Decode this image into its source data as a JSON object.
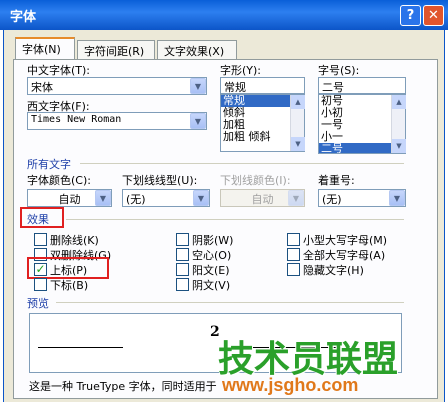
{
  "window": {
    "title": "字体",
    "help_label": "?",
    "close_label": "✕"
  },
  "tabs": [
    {
      "label": "字体(N)",
      "active": true
    },
    {
      "label": "字符间距(R)",
      "active": false
    },
    {
      "label": "文字效果(X)",
      "active": false
    }
  ],
  "font": {
    "chinese_label": "中文字体(T):",
    "chinese_value": "宋体",
    "western_label": "西文字体(F):",
    "western_value": "Times New Roman",
    "style_label": "字形(Y):",
    "style_value": "常规",
    "style_items": [
      "常规",
      "倾斜",
      "加粗",
      "加粗 倾斜"
    ],
    "size_label": "字号(S):",
    "size_value": "二号",
    "size_items": [
      "初号",
      "小初",
      "一号",
      "小一",
      "二号"
    ]
  },
  "all_text": {
    "heading": "所有文字",
    "color_label": "字体颜色(C):",
    "color_value": "自动",
    "underline_label": "下划线线型(U):",
    "underline_value": "(无)",
    "underline_color_label": "下划线颜色(I):",
    "underline_color_value": "自动",
    "emphasis_label": "着重号:",
    "emphasis_value": "(无)"
  },
  "effects": {
    "heading": "效果",
    "col1": [
      {
        "label": "删除线(K)",
        "checked": false
      },
      {
        "label": "双删除线(G)",
        "checked": false
      },
      {
        "label": "上标(P)",
        "checked": true
      },
      {
        "label": "下标(B)",
        "checked": false
      }
    ],
    "col2": [
      {
        "label": "阴影(W)",
        "checked": false
      },
      {
        "label": "空心(O)",
        "checked": false
      },
      {
        "label": "阳文(E)",
        "checked": false
      },
      {
        "label": "阴文(V)",
        "checked": false
      }
    ],
    "col3": [
      {
        "label": "小型大写字母(M)",
        "checked": false
      },
      {
        "label": "全部大写字母(A)",
        "checked": false
      },
      {
        "label": "隐藏文字(H)",
        "checked": false
      }
    ]
  },
  "preview": {
    "heading": "预览",
    "sample": "2",
    "note": "这是一种 TrueType 字体，同时适用于"
  },
  "watermark": {
    "title": "技术员联盟",
    "url": "www.jsgho.com"
  }
}
